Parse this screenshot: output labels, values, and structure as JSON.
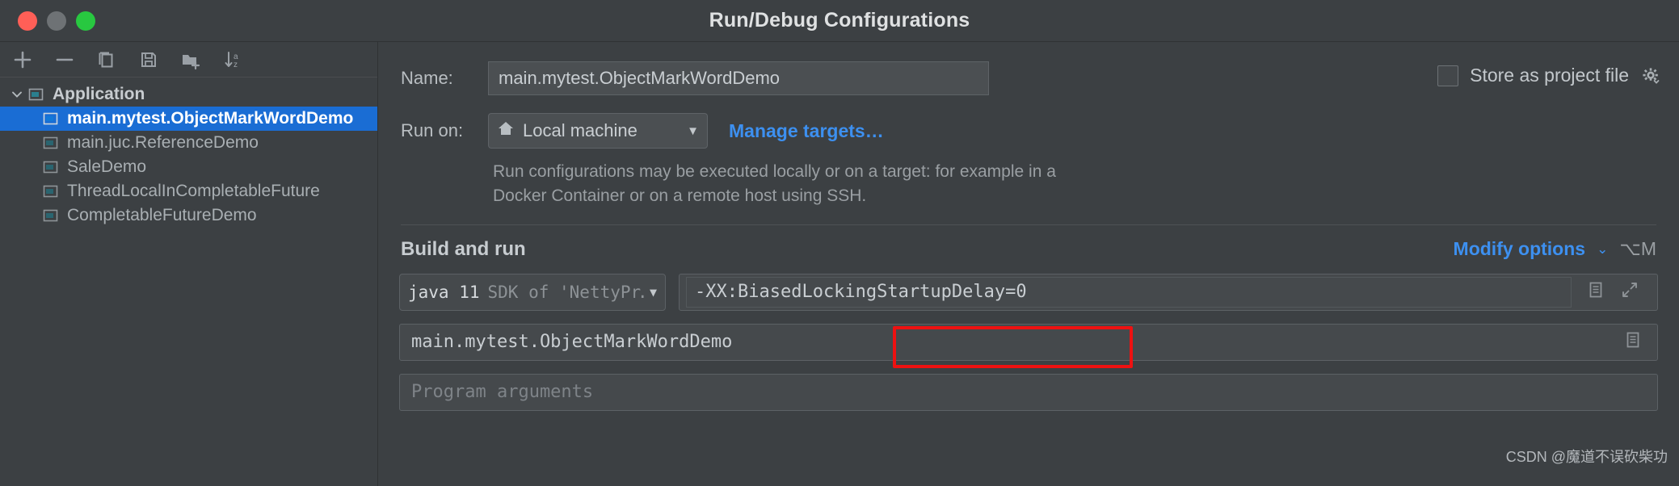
{
  "window": {
    "title": "Run/Debug Configurations",
    "traffic_lights": [
      "close-button",
      "minimize-button",
      "zoom-button"
    ]
  },
  "toolbar": {
    "buttons": [
      {
        "name": "add-configuration-button",
        "icon": "plus-icon",
        "label": "+"
      },
      {
        "name": "remove-configuration-button",
        "icon": "minus-icon",
        "label": "−"
      },
      {
        "name": "copy-configuration-button",
        "icon": "copy-icon",
        "label": "Copy Configuration"
      },
      {
        "name": "save-configuration-button",
        "icon": "save-icon",
        "label": "Save Configuration"
      },
      {
        "name": "move-into-folder-button",
        "icon": "new-folder-icon",
        "label": "Move into new folder"
      },
      {
        "name": "sort-configurations-button",
        "icon": "sort-az-icon",
        "label": "Sort Configurations"
      }
    ]
  },
  "sidebar": {
    "group": {
      "label": "Application",
      "expanded": true,
      "icon": "application-config-icon"
    },
    "items": [
      {
        "label": "main.mytest.ObjectMarkWordDemo",
        "selected": true,
        "icon": "run-config-icon"
      },
      {
        "label": "main.juc.ReferenceDemo",
        "selected": false,
        "icon": "run-config-icon"
      },
      {
        "label": "SaleDemo",
        "selected": false,
        "icon": "run-config-icon"
      },
      {
        "label": "ThreadLocalInCompletableFuture",
        "selected": false,
        "icon": "run-config-icon"
      },
      {
        "label": "CompletableFutureDemo",
        "selected": false,
        "icon": "run-config-icon"
      }
    ]
  },
  "form": {
    "name_label": "Name:",
    "name_value": "main.mytest.ObjectMarkWordDemo",
    "store_as_project_file": {
      "label": "Store as project file",
      "checked": false,
      "gear_icon": "gear-dropdown-icon"
    },
    "run_on_label": "Run on:",
    "run_on_value": "Local machine",
    "run_on_icon": "home-icon",
    "manage_targets_link": "Manage targets…",
    "help_text": "Run configurations may be executed locally or on a target: for example in a Docker Container or on a remote host using SSH."
  },
  "build_and_run": {
    "section_title": "Build and run",
    "modify_options_link": "Modify options",
    "modify_options_shortcut": "⌥M",
    "jdk": {
      "main": "java 11",
      "sub": "SDK of 'NettyPr…"
    },
    "vm_options": {
      "value": "-XX:BiasedLockingStartupDelay=0",
      "icons": [
        "macro-icon",
        "expand-icon"
      ]
    },
    "main_class": {
      "value": "main.mytest.ObjectMarkWordDemo",
      "icons": [
        "macro-icon"
      ]
    },
    "program_arguments": {
      "placeholder": "Program arguments"
    }
  },
  "annotation": {
    "color": "#ee1111",
    "target": "vm-options-field"
  },
  "watermark": {
    "text": "CSDN @魔道不误砍柴功"
  }
}
